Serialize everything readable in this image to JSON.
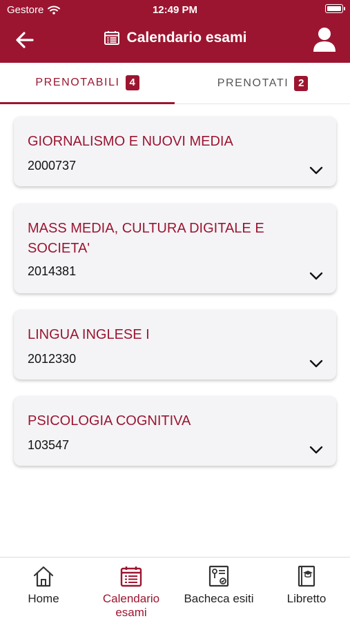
{
  "status_bar": {
    "carrier": "Gestore",
    "time": "12:49 PM"
  },
  "header": {
    "title": "Calendario esami"
  },
  "tabs": [
    {
      "label": "PRENOTABILI",
      "badge": "4"
    },
    {
      "label": "PRENOTATI",
      "badge": "2"
    }
  ],
  "exams": [
    {
      "title": "GIORNALISMO E NUOVI MEDIA",
      "code": "2000737"
    },
    {
      "title": "MASS MEDIA, CULTURA DIGITALE E SOCIETA'",
      "code": "2014381"
    },
    {
      "title": "LINGUA INGLESE I",
      "code": "2012330"
    },
    {
      "title": "PSICOLOGIA COGNITIVA",
      "code": "103547"
    }
  ],
  "bottom_nav": [
    {
      "label": "Home",
      "icon": "home-icon"
    },
    {
      "label": "Calendario esami",
      "icon": "calendar-list-icon"
    },
    {
      "label": "Bacheca esiti",
      "icon": "certificate-icon"
    },
    {
      "label": "Libretto",
      "icon": "book-icon"
    }
  ],
  "colors": {
    "brand": "#9c1530",
    "card_bg": "#f4f4f7",
    "text": "#111111"
  }
}
